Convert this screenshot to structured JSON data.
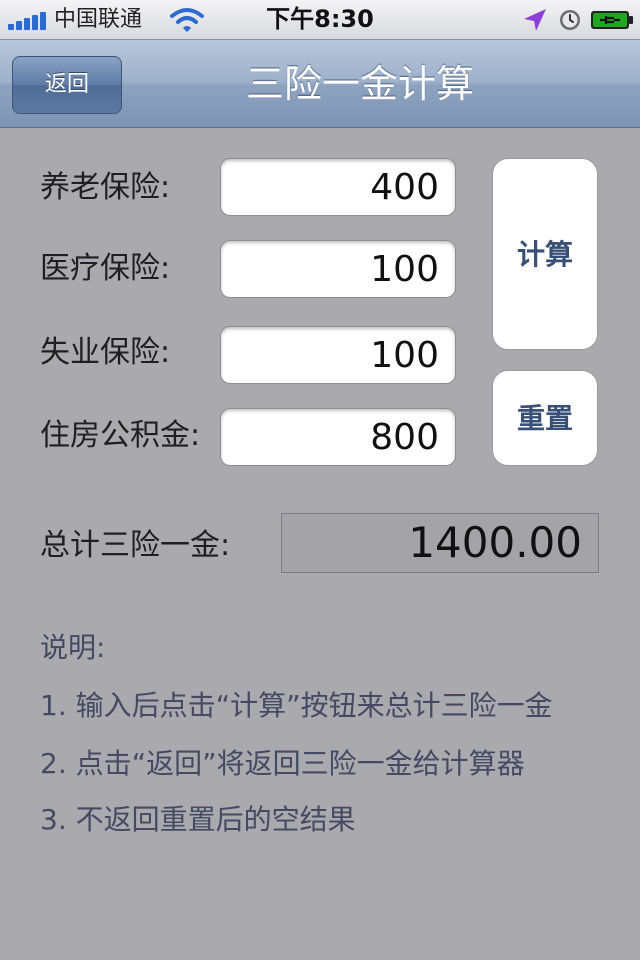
{
  "status_bar": {
    "carrier": "中国联通",
    "time": "下午8:30"
  },
  "nav": {
    "back_label": "返回",
    "title": "三险一金计算"
  },
  "form": {
    "rows": [
      {
        "label": "养老保险:",
        "value": "400"
      },
      {
        "label": "医疗保险:",
        "value": "100"
      },
      {
        "label": "失业保险:",
        "value": "100"
      },
      {
        "label": "住房公积金:",
        "value": "800"
      }
    ],
    "calc_label": "计算",
    "reset_label": "重置",
    "total_label": "总计三险一金:",
    "total_value": "1400.00"
  },
  "notes": {
    "title": "说明:",
    "lines": [
      "1. 输入后点击“计算”按钮来总计三险一金",
      "2. 点击“返回”将返回三险一金给计算器",
      "3. 不返回重置后的空结果"
    ]
  },
  "colors": {
    "background": "#a9a9ae",
    "nav_bar": "#8ea3c0",
    "button_text": "#385078",
    "signal": "#2c6bd0",
    "battery": "#1fa81f",
    "location_arrow": "#8e3fd6"
  },
  "icons": [
    "signal-bars-icon",
    "wifi-icon",
    "location-arrow-icon",
    "alarm-clock-icon",
    "battery-charging-icon"
  ]
}
